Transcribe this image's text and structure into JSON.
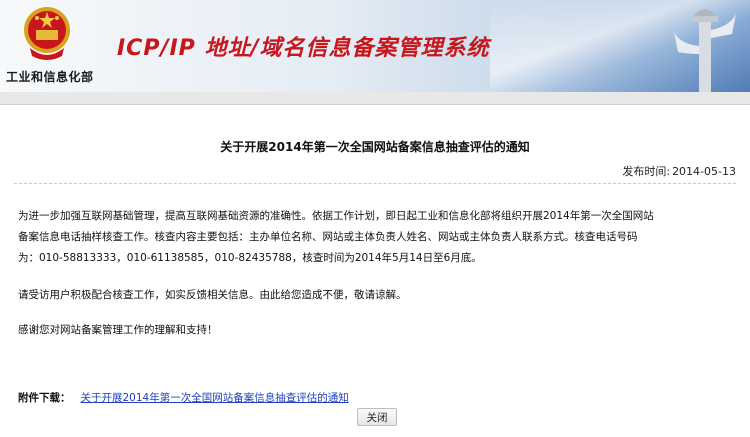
{
  "header": {
    "ministry": "工业和信息化部",
    "system_title": "ICP/IP 地址/域名信息备案管理系统"
  },
  "notice": {
    "title": "关于开展2014年第一次全国网站备案信息抽查评估的通知",
    "publish_label": "发布时间:",
    "publish_date": "2014-05-13",
    "paragraphs": [
      "为进一步加强互联网基础管理，提高互联网基础资源的准确性。依据工作计划，即日起工业和信息化部将组织开展2014年第一次全国网站备案信息电话抽样核查工作。核查内容主要包括：主办单位名称、网站或主体负责人姓名、网站或主体负责人联系方式。核查电话号码为：010-58813333，010-61138585，010-82435788，核查时间为2014年5月14日至6月底。",
      "请受访用户积极配合核查工作，如实反馈相关信息。由此给您造成不便，敬请谅解。",
      "感谢您对网站备案管理工作的理解和支持！"
    ],
    "attachment_label": "附件下载：",
    "attachment_link": "关于开展2014年第一次全国网站备案信息抽查评估的通知",
    "close_button": "关闭"
  },
  "colors": {
    "title_red": "#c8161d",
    "link_blue": "#1f3fbf"
  }
}
